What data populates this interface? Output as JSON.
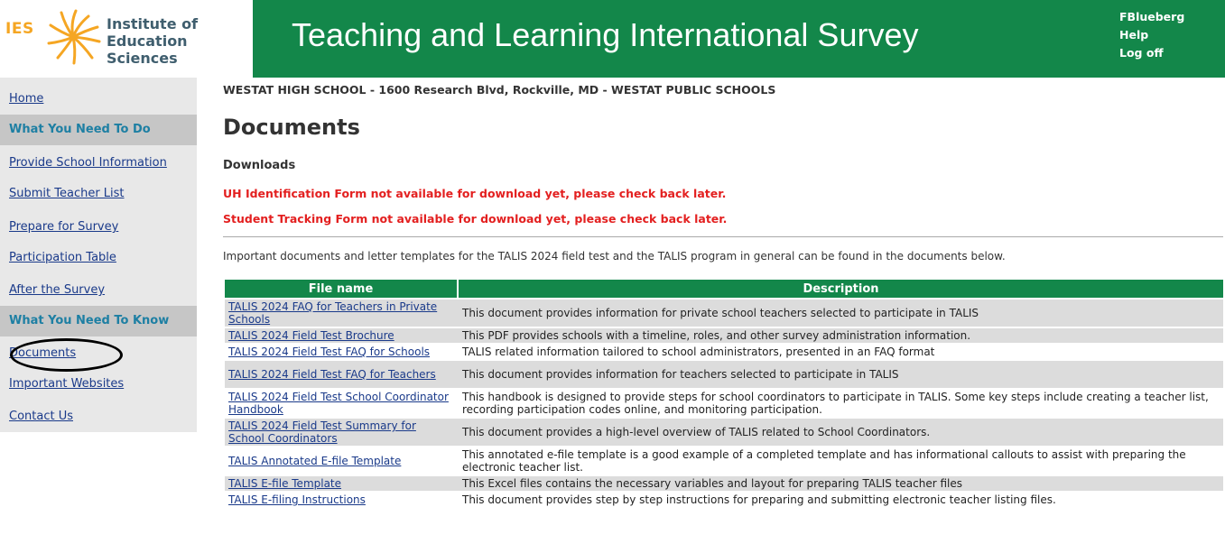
{
  "header": {
    "logo_ies": "IES",
    "logo_line1": "Institute of",
    "logo_line2": "Education Sciences",
    "title": "Teaching and Learning International Survey",
    "user_links": [
      "FBlueberg",
      "Help",
      "Log off"
    ]
  },
  "sidebar": {
    "home": "Home",
    "section1": "What You Need To Do",
    "todo_items": [
      "Provide School Information",
      "Submit Teacher List",
      "Prepare for Survey",
      "Participation Table",
      "After the Survey"
    ],
    "section2": "What You Need To Know",
    "know_items": [
      "Documents",
      "Important Websites",
      "Contact Us"
    ]
  },
  "main": {
    "school_line": "WESTAT HIGH SCHOOL  -  1600 Research Blvd, Rockville, MD  -  WESTAT PUBLIC SCHOOLS",
    "page_title": "Documents",
    "downloads_heading": "Downloads",
    "warnings": [
      "UH Identification Form not available for download yet, please check back later.",
      "Student Tracking Form not available for download yet, please check back later."
    ],
    "intro": "Important documents and letter templates for the TALIS 2024 field test and the TALIS program in general can be found in the documents below."
  },
  "table": {
    "headers": [
      "File name",
      "Description"
    ],
    "rows": [
      {
        "file": " TALIS 2024 FAQ for Teachers in Private Schools",
        "desc": "This document provides information for private school teachers selected to participate in TALIS"
      },
      {
        "file": " TALIS 2024 Field Test Brochure",
        "desc": "This PDF provides schools with a timeline, roles, and other survey administration information."
      },
      {
        "file": " TALIS 2024 Field Test FAQ for Schools",
        "desc": "TALIS related information tailored to school administrators, presented in an FAQ format"
      },
      {
        "file": " TALIS 2024 Field Test FAQ for Teachers",
        "desc": "This document provides information for teachers selected to participate in TALIS"
      },
      {
        "file": " TALIS 2024 Field Test School Coordinator Handbook",
        "desc": "This handbook is designed to provide steps for school coordinators to participate in TALIS. Some key steps include creating a teacher list, recording participation codes online, and monitoring participation."
      },
      {
        "file": " TALIS 2024 Field Test Summary for School Coordinators",
        "desc": "This document provides a high-level overview of TALIS related to School Coordinators."
      },
      {
        "file": " TALIS Annotated E-file Template",
        "desc": "This annotated e-file template is a good example of a completed template and has informational callouts to assist with preparing the electronic teacher list."
      },
      {
        "file": " TALIS E-file Template",
        "desc": "This Excel files contains the necessary variables and layout for preparing TALIS teacher files"
      },
      {
        "file": " TALIS E-filing Instructions",
        "desc": "This document provides step by step instructions for preparing and submitting electronic teacher listing files."
      }
    ]
  },
  "colors": {
    "header_green": "#13874a",
    "link_blue": "#1a3a8a",
    "section_teal": "#1d7fa3",
    "warning_red": "#e31f1f",
    "ies_orange": "#f5a623"
  }
}
